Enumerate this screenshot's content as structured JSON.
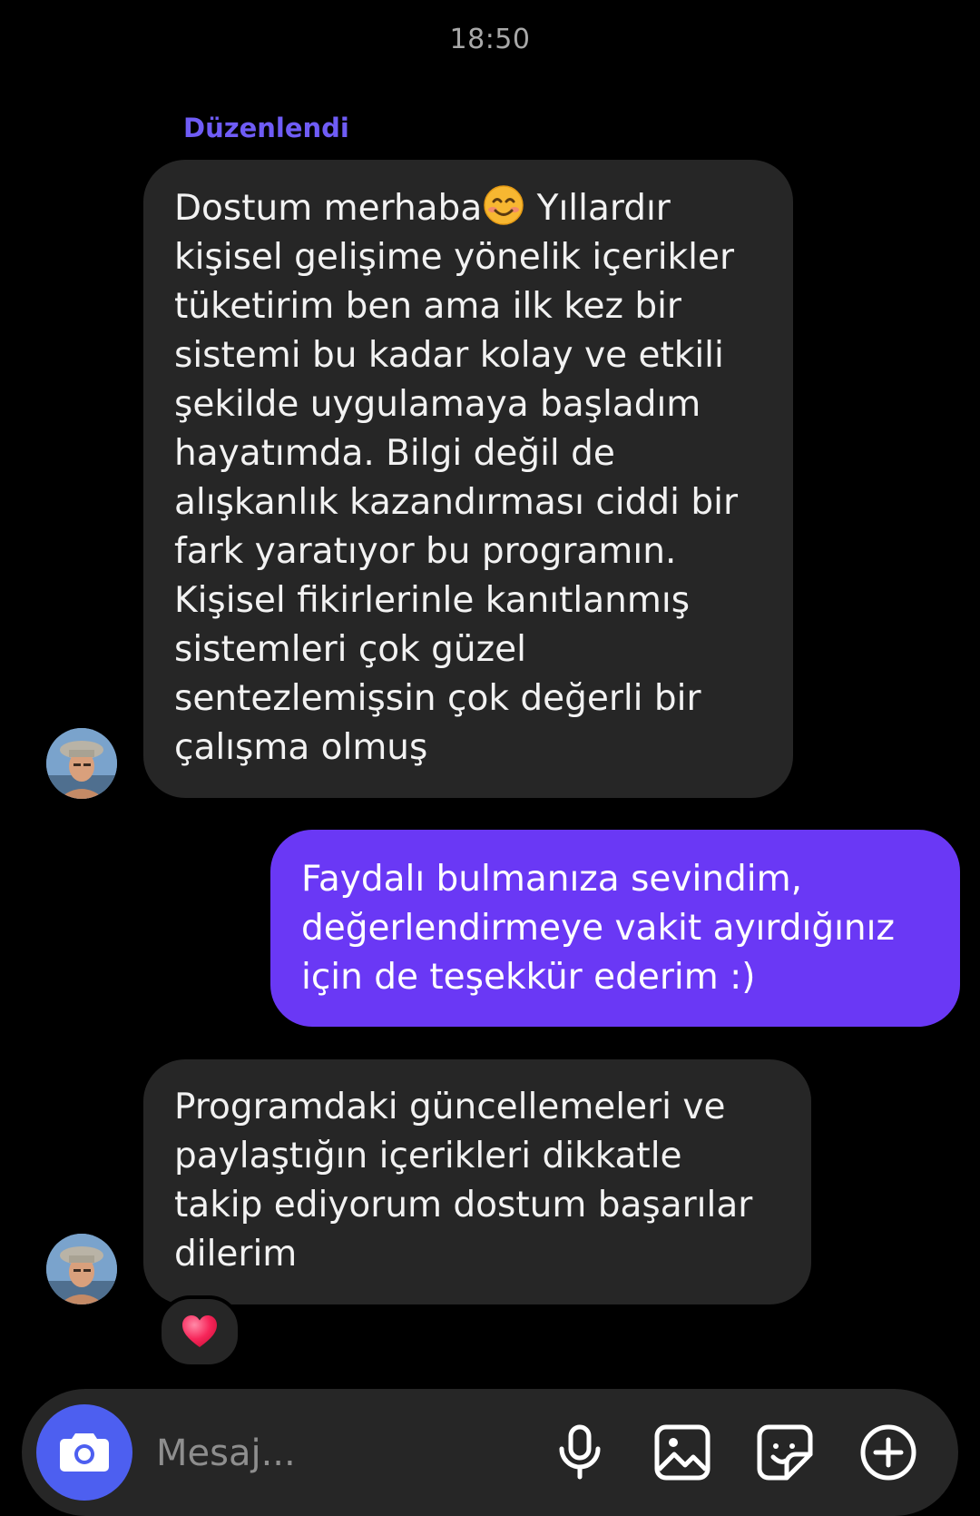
{
  "header": {
    "time": "18:50"
  },
  "messages": [
    {
      "direction": "incoming",
      "edited_label": "Düzenlendi",
      "lines": [
        "Dostum merhaba",
        "kişisel gelişime yönelik içerikler",
        "tüketirim ben ama ilk kez bir",
        "sistemi bu kadar kolay ve etkili",
        "şekilde uygulamaya başladım",
        "hayatımda. Bilgi değil de",
        "alışkanlık kazandırması ciddi bir",
        "fark yaratıyor bu programın.",
        "Kişisel fikirlerinle kanıtlanmış",
        "sistemleri çok güzel",
        "sentezlemişsin çok değerli bir",
        "çalışma olmuş"
      ],
      "line1_suffix": " Yıllardır",
      "emoji": "smiling-face-icon"
    },
    {
      "direction": "outgoing",
      "lines": [
        "Faydalı bulmanıza sevindim,",
        "değerlendirmeye vakit ayırdığınız",
        "için de teşekkür ederim :)"
      ]
    },
    {
      "direction": "incoming",
      "lines": [
        "Programdaki güncellemeleri ve",
        "paylaştığın içerikleri dikkatle",
        "takip ediyorum dostum başarılar",
        "dilerim"
      ],
      "reaction": "heart-icon"
    }
  ],
  "composer": {
    "placeholder": "Mesaj...",
    "icons": [
      "camera-icon",
      "microphone-icon",
      "gallery-icon",
      "sticker-icon",
      "plus-icon"
    ]
  },
  "colors": {
    "background": "#000000",
    "incoming_bubble": "#262626",
    "outgoing_bubble": "#6a38f5",
    "edited_label": "#6f5cf6",
    "camera_button": "#4d5ff0"
  }
}
